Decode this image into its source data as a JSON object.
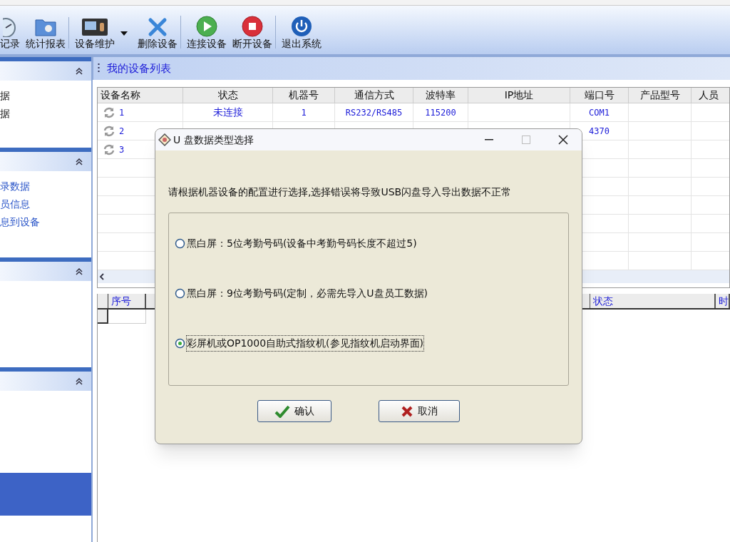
{
  "toolbar": {
    "groups": [
      {
        "items": [
          {
            "label": "记录"
          },
          {
            "label": "统计报表"
          }
        ]
      },
      {
        "items": [
          {
            "label": "设备维护",
            "dropdown": true
          },
          {
            "label": "删除设备"
          }
        ]
      },
      {
        "items": [
          {
            "label": "连接设备"
          },
          {
            "label": "断开设备"
          }
        ]
      },
      {
        "items": [
          {
            "label": "退出系统"
          }
        ]
      }
    ]
  },
  "sidebar": {
    "sections": [
      {
        "expanded": true,
        "items": [
          {
            "label": "据",
            "kind": "plain"
          },
          {
            "label": "据",
            "kind": "plain"
          }
        ]
      },
      {
        "expanded": true,
        "items": [
          {
            "label": "录数据",
            "kind": "link"
          },
          {
            "label": "员信息",
            "kind": "link"
          },
          {
            "label": "息到设备",
            "kind": "link"
          }
        ]
      },
      {
        "expanded": true
      },
      {
        "expanded": true
      }
    ]
  },
  "main": {
    "title": "我的设备列表",
    "device_table": {
      "columns": [
        "设备名称",
        "状态",
        "机器号",
        "通信方式",
        "波特率",
        "IP地址",
        "端口号",
        "产品型号",
        "人员"
      ],
      "rows": [
        {
          "name": "1",
          "status": "未连接",
          "machine_no": "1",
          "comm": "RS232/RS485",
          "baud": "115200",
          "port": "COM1"
        },
        {
          "name": "2",
          "port": "4370"
        },
        {
          "name": "3"
        }
      ]
    },
    "record_table": {
      "columns_left": [
        "序号"
      ],
      "columns_right": [
        "状态",
        "时"
      ]
    }
  },
  "dialog": {
    "title": "U 盘数据类型选择",
    "message": "请根据机器设备的配置进行选择,选择错误将导致USB闪盘导入导出数据不正常",
    "options": [
      {
        "label": "黑白屏：5位考勤号码(设备中考勤号码长度不超过5)",
        "selected": false
      },
      {
        "label": "黑白屏：9位考勤号码(定制，必需先导入U盘员工数据)",
        "selected": false
      },
      {
        "label": "彩屏机或OP1000自助式指纹机(参见指纹机启动界面)",
        "selected": true
      }
    ],
    "buttons": [
      {
        "label": "确认",
        "kind": "ok"
      },
      {
        "label": "取消",
        "kind": "cancel"
      }
    ]
  }
}
